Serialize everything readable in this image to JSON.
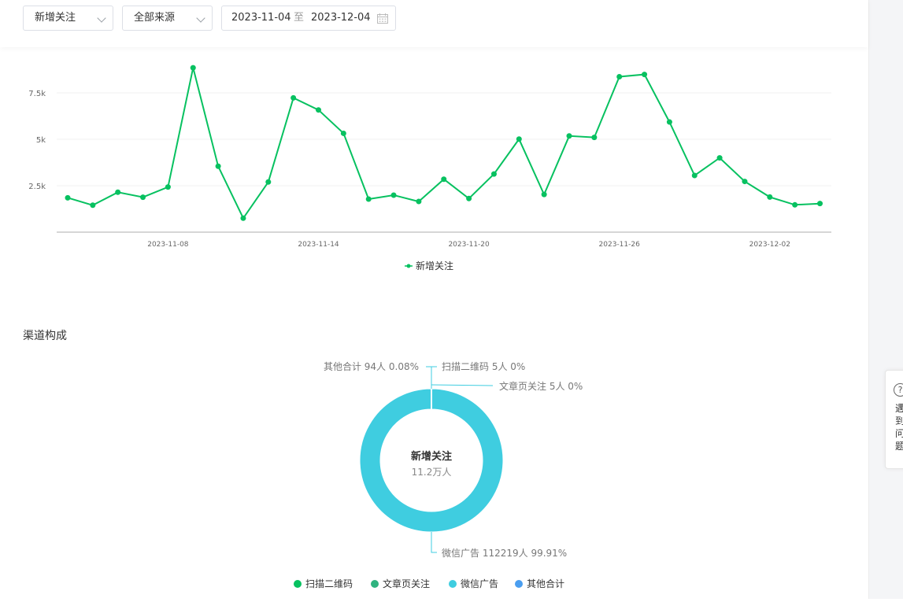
{
  "filters": {
    "metric_select": "新增关注",
    "source_select": "全部来源",
    "date_start": "2023-11-04",
    "date_separator": "至",
    "date_end": "2023-12-04"
  },
  "chart_data": [
    {
      "type": "line",
      "title": "",
      "x": [
        "2023-11-04",
        "2023-11-05",
        "2023-11-06",
        "2023-11-07",
        "2023-11-08",
        "2023-11-09",
        "2023-11-10",
        "2023-11-11",
        "2023-11-12",
        "2023-11-13",
        "2023-11-14",
        "2023-11-15",
        "2023-11-16",
        "2023-11-17",
        "2023-11-18",
        "2023-11-19",
        "2023-11-20",
        "2023-11-21",
        "2023-11-22",
        "2023-11-23",
        "2023-11-24",
        "2023-11-25",
        "2023-11-26",
        "2023-11-27",
        "2023-11-28",
        "2023-11-29",
        "2023-11-30",
        "2023-12-01",
        "2023-12-02",
        "2023-12-03",
        "2023-12-04"
      ],
      "series": [
        {
          "name": "新增关注",
          "color": "#07c160",
          "values": [
            1850,
            1450,
            2150,
            1880,
            2430,
            8850,
            3550,
            750,
            2700,
            7230,
            6580,
            5320,
            1780,
            1990,
            1650,
            2850,
            1810,
            3130,
            5010,
            2030,
            5180,
            5100,
            8370,
            8490,
            5930,
            3050,
            4000,
            2730,
            1890,
            1470,
            1540
          ]
        }
      ],
      "x_tick_labels": [
        "2023-11-08",
        "2023-11-14",
        "2023-11-20",
        "2023-11-26",
        "2023-12-02"
      ],
      "y_tick_labels": [
        "2.5k",
        "5k",
        "7.5k"
      ],
      "y_ticks": [
        2500,
        5000,
        7500
      ],
      "ylim": [
        0,
        10000
      ],
      "grid": true,
      "legend": "bottom-center"
    },
    {
      "type": "pie",
      "title": "渠道构成",
      "center_title": "新增关注",
      "center_value": "11.2万人",
      "categories": [
        "扫描二维码",
        "文章页关注",
        "微信广告",
        "其他合计"
      ],
      "values": [
        5,
        5,
        112219,
        94
      ],
      "colors": [
        "#07c160",
        "#2fb37f",
        "#3fcde0",
        "#4a9ef0"
      ],
      "slice_labels": [
        "扫描二维码 5人 0%",
        "文章页关注 5人 0%",
        "微信广告 112219人 99.91%",
        "其他合计 94人 0.08%"
      ],
      "legend": "bottom-center"
    }
  ],
  "help_tab": {
    "icon": "question-icon",
    "text": "遇到问题"
  }
}
